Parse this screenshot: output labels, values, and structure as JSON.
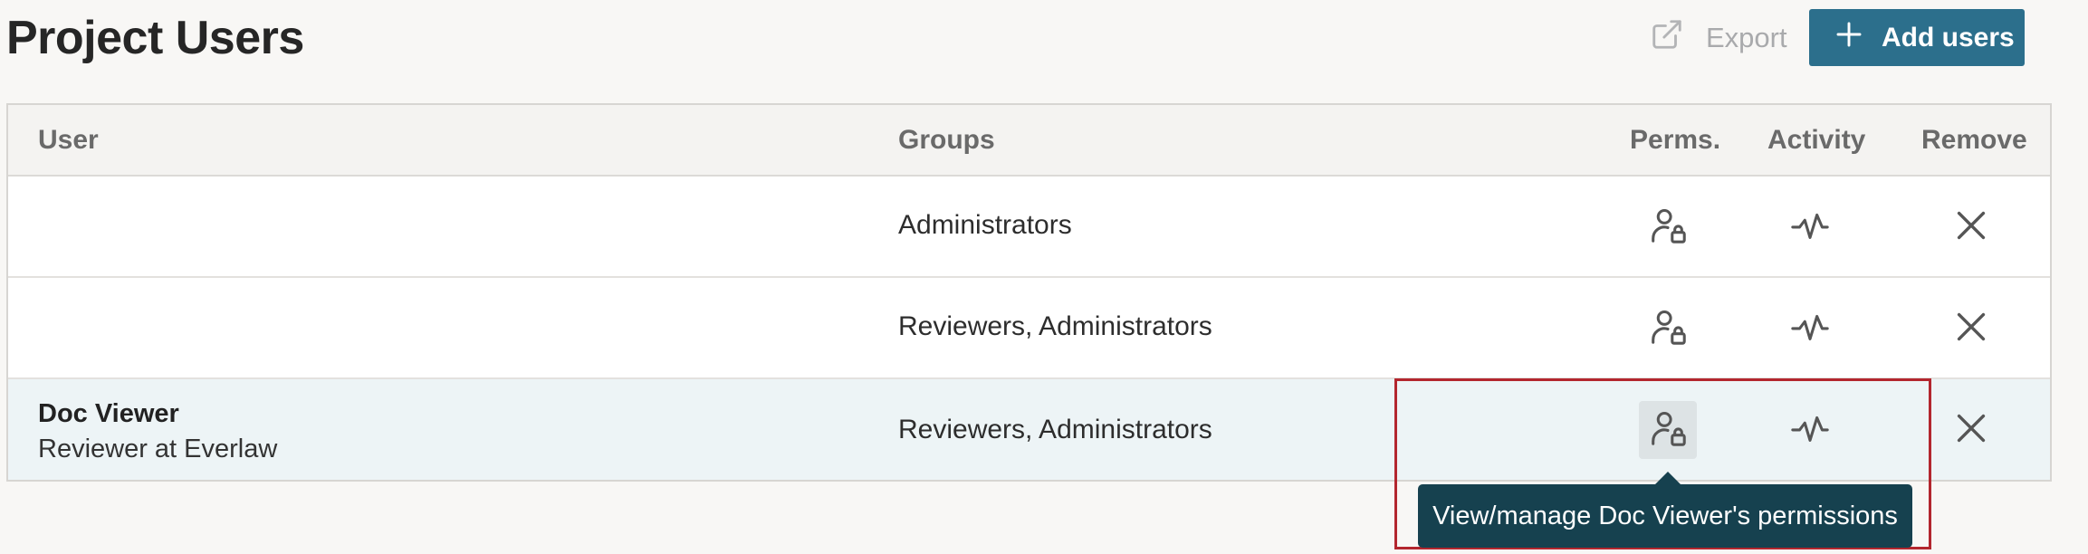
{
  "page": {
    "title": "Project Users"
  },
  "toolbar": {
    "export_label": "Export",
    "export_icon": "external-link-icon",
    "add_users_label": "Add users",
    "add_users_icon": "plus-icon",
    "accent_color": "#2c6f8c"
  },
  "table": {
    "columns": {
      "user": "User",
      "groups": "Groups",
      "perms": "Perms.",
      "activity": "Activity",
      "remove": "Remove"
    },
    "rows": [
      {
        "name": "",
        "role": "",
        "groups": "Administrators"
      },
      {
        "name": "",
        "role": "",
        "groups": "Reviewers, Administrators"
      },
      {
        "name": "Doc Viewer",
        "role": "Reviewer at Everlaw",
        "groups": "Reviewers, Administrators"
      }
    ],
    "row_icons": {
      "perms": "user-lock-icon",
      "activity": "activity-pulse-icon",
      "remove": "close-icon"
    }
  },
  "tooltip": {
    "text": "View/manage Doc Viewer's permissions",
    "background": "#16414f"
  },
  "highlight": {
    "color": "#b3262e"
  }
}
